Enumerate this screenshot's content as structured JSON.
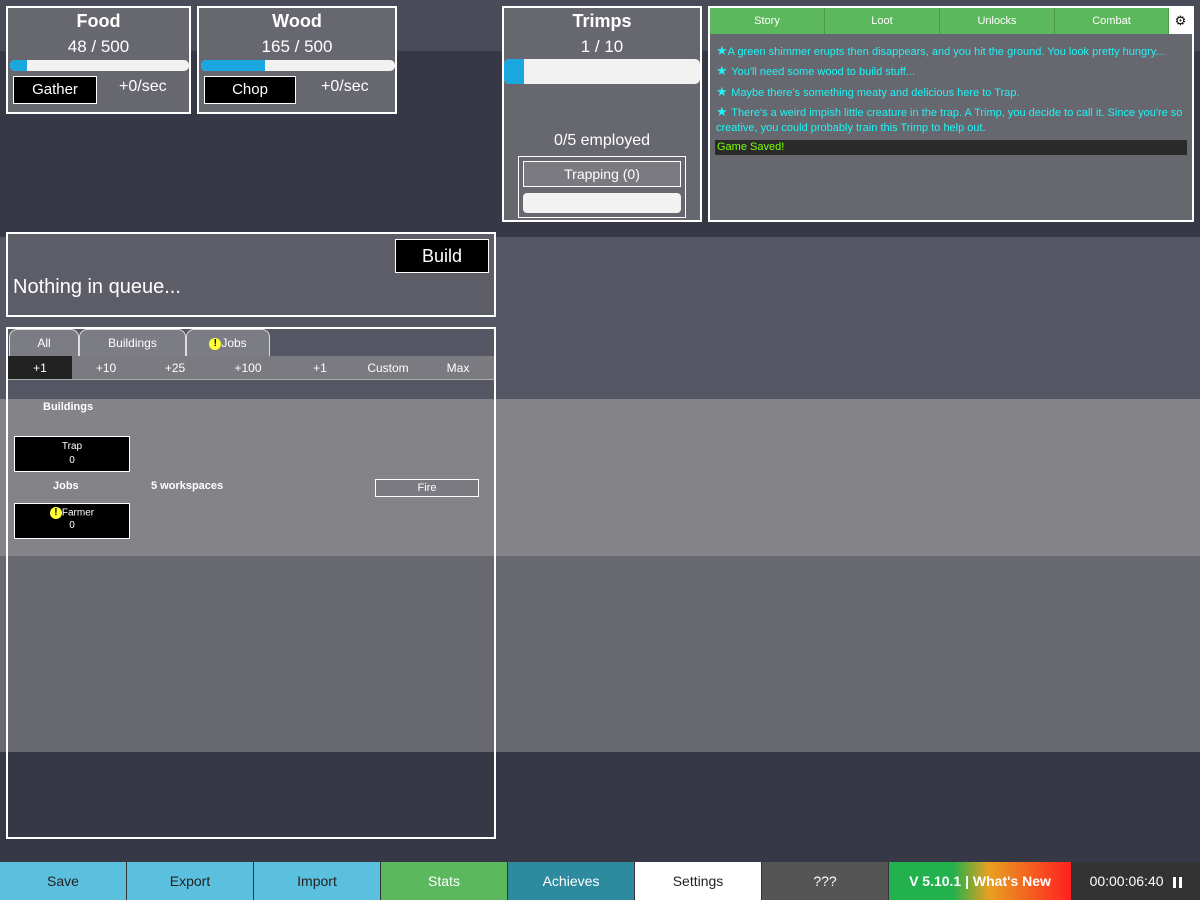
{
  "food": {
    "title": "Food",
    "amount": "48 / 500",
    "fill": 0.096,
    "button": "Gather",
    "rate": "+0/sec"
  },
  "wood": {
    "title": "Wood",
    "amount": "165 / 500",
    "fill": 0.33,
    "button": "Chop",
    "rate": "+0/sec"
  },
  "trimps": {
    "title": "Trimps",
    "count": "1 / 10",
    "fill": 0.1,
    "employed": "0/5 employed",
    "trap_button": "Trapping (0)"
  },
  "log": {
    "tabs": [
      "Story",
      "Loot",
      "Unlocks",
      "Combat"
    ],
    "settings_icon": "gear-icon",
    "messages": [
      "A green shimmer erupts then disappears, and you hit the ground. You look pretty hungry...",
      "You'll need some wood to build stuff...",
      "Maybe there's something meaty and delicious here to Trap.",
      "There's a weird impish little creature in the trap. A Trimp, you decide to call it. Since you're so creative, you could probably train this Trimp to help out."
    ],
    "saved": "Game Saved!"
  },
  "queue": {
    "build_button": "Build",
    "empty_text": "Nothing in queue..."
  },
  "buy": {
    "tabs": [
      "All",
      "Buildings",
      "Jobs"
    ],
    "amounts": [
      "+1",
      "+10",
      "+25",
      "+100",
      "+1",
      "Custom",
      "Max"
    ],
    "buildings_label": "Buildings",
    "trap": {
      "name": "Trap",
      "count": "0"
    },
    "jobs_label": "Jobs",
    "workspaces": "5 workspaces",
    "fire_button": "Fire",
    "farmer": {
      "name": "Farmer",
      "count": "0"
    },
    "alert_glyph": "!"
  },
  "footer": {
    "buttons": [
      "Save",
      "Export",
      "Import",
      "Stats",
      "Achieves",
      "Settings",
      "???"
    ],
    "version": "V 5.10.1 | What's New",
    "time": "00:00:06:40",
    "pause_icon": "pause-icon"
  },
  "colors": {
    "accent": "#1aa7e0",
    "log_green": "#5cb85c",
    "log_text": "#1ef4f4",
    "saved_text": "#7fff00"
  }
}
